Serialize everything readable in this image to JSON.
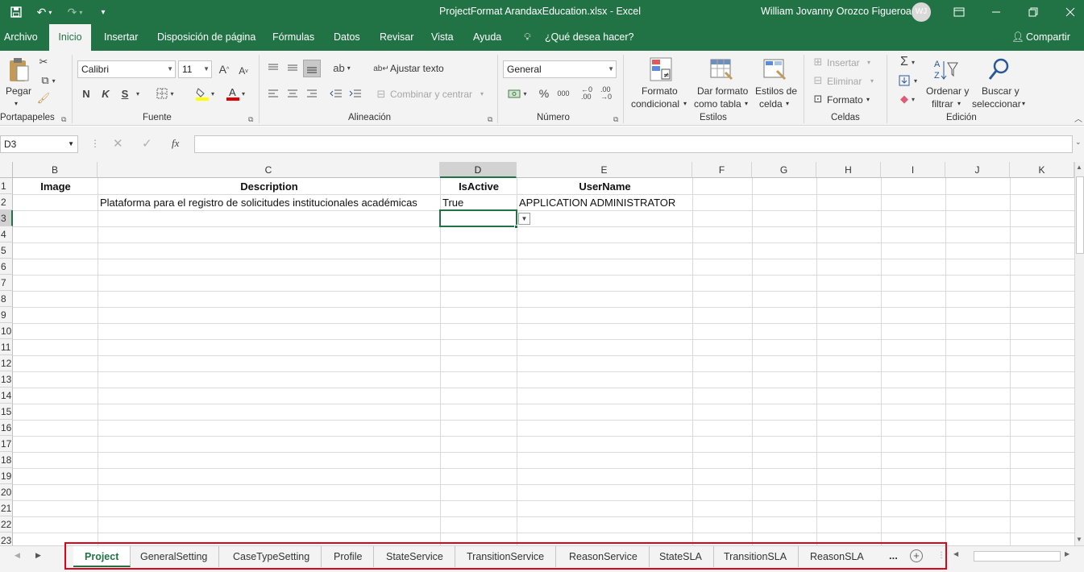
{
  "window": {
    "title": "ProjectFormat ArandaxEducation.xlsx  -  Excel",
    "user_name": "William Jovanny Orozco Figueroa",
    "user_initials": "WJ"
  },
  "ribbon_tabs": [
    "Archivo",
    "Inicio",
    "Insertar",
    "Disposición de página",
    "Fórmulas",
    "Datos",
    "Revisar",
    "Vista",
    "Ayuda"
  ],
  "tell_me": "¿Qué desea hacer?",
  "share_label": "Compartir",
  "ribbon": {
    "clipboard": {
      "paste": "Pegar",
      "group": "Portapapeles"
    },
    "font": {
      "name": "Calibri",
      "size": "11",
      "bold": "N",
      "italic": "K",
      "underline": "S",
      "group": "Fuente"
    },
    "alignment": {
      "wrap": "Ajustar texto",
      "merge": "Combinar y centrar",
      "group": "Alineación"
    },
    "number": {
      "format": "General",
      "percent": "%",
      "thousands": "000",
      "group": "Número"
    },
    "styles": {
      "conditional": [
        "Formato",
        "condicional"
      ],
      "table": [
        "Dar formato",
        "como tabla"
      ],
      "cell": [
        "Estilos de",
        "celda"
      ],
      "group": "Estilos"
    },
    "cells": {
      "insert": "Insertar",
      "delete": "Eliminar",
      "format": "Formato",
      "group": "Celdas"
    },
    "editing": {
      "sort": [
        "Ordenar y",
        "filtrar"
      ],
      "find": [
        "Buscar y",
        "seleccionar"
      ],
      "group": "Edición"
    }
  },
  "formula_bar": {
    "name_box": "D3",
    "fx": "fx",
    "value": ""
  },
  "columns": [
    "B",
    "C",
    "D",
    "E",
    "F",
    "G",
    "H",
    "I",
    "J",
    "K"
  ],
  "rows": [
    "1",
    "2",
    "3",
    "4",
    "5",
    "6",
    "7",
    "8",
    "9",
    "10",
    "11",
    "12",
    "13",
    "14",
    "15",
    "16",
    "17",
    "18",
    "19",
    "20",
    "21",
    "22",
    "23"
  ],
  "cells": {
    "B1": "Image",
    "C1": "Description",
    "D1": "IsActive",
    "E1": "UserName",
    "C2": "Plataforma para el registro de solicitudes institucionales académicas",
    "D2": "True",
    "E2": "APPLICATION ADMINISTRATOR"
  },
  "selected_cell": "D3",
  "sheet_tabs": [
    "Project",
    "GeneralSetting",
    "CaseTypeSetting",
    "Profile",
    "StateService",
    "TransitionService",
    "ReasonService",
    "StateSLA",
    "TransitionSLA",
    "ReasonSLA"
  ],
  "active_sheet": "Project",
  "more_tabs": "...",
  "accent_color": "#217346",
  "highlight_color": "#e1001a"
}
